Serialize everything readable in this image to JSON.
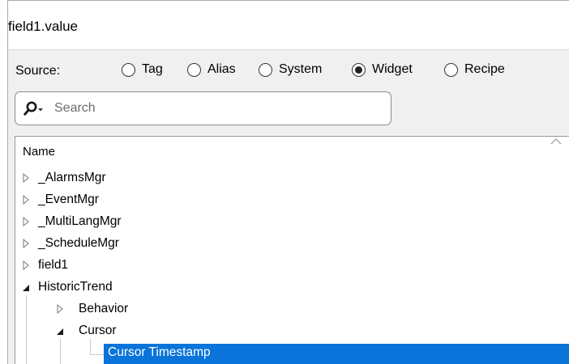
{
  "dialog": {
    "title": "field1.value"
  },
  "source": {
    "label": "Source:",
    "options": [
      {
        "label": "Tag",
        "selected": false
      },
      {
        "label": "Alias",
        "selected": false
      },
      {
        "label": "System",
        "selected": false
      },
      {
        "label": "Widget",
        "selected": true
      },
      {
        "label": "Recipe",
        "selected": false
      }
    ]
  },
  "search": {
    "placeholder": "Search",
    "value": ""
  },
  "tree": {
    "column_header": "Name",
    "items": [
      {
        "label": "_AlarmsMgr",
        "expanded": false
      },
      {
        "label": "_EventMgr",
        "expanded": false
      },
      {
        "label": "_MultiLangMgr",
        "expanded": false
      },
      {
        "label": "_ScheduleMgr",
        "expanded": false
      },
      {
        "label": "field1",
        "expanded": false
      },
      {
        "label": "HistoricTrend",
        "expanded": true,
        "children": [
          {
            "label": "Behavior",
            "expanded": false
          },
          {
            "label": "Cursor",
            "expanded": true,
            "children": [
              {
                "label": "Cursor Timestamp",
                "selected": true
              }
            ]
          }
        ]
      }
    ]
  },
  "colors": {
    "selection": "#0a74da",
    "panel": "#f0f0f0"
  }
}
